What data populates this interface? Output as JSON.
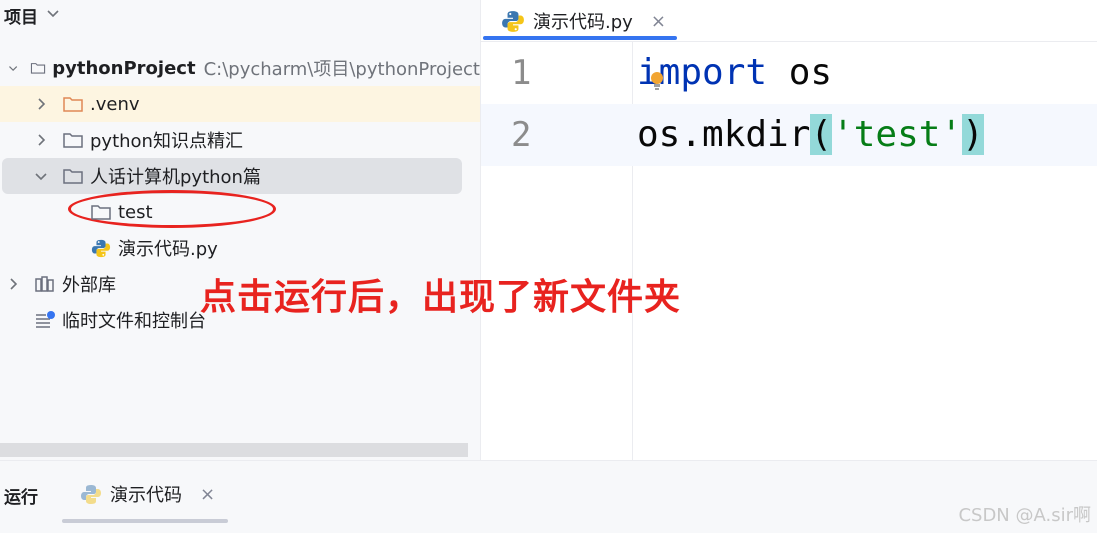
{
  "project_panel": {
    "title": "项目",
    "tree": [
      {
        "label": "pythonProject",
        "hint": "C:\\pycharm\\项目\\pythonProject"
      },
      {
        "label": ".venv"
      },
      {
        "label": "python知识点精汇"
      },
      {
        "label": "人话计算机python篇"
      },
      {
        "label": "test"
      },
      {
        "label": "演示代码.py"
      },
      {
        "label": "外部库"
      },
      {
        "label": "临时文件和控制台"
      }
    ]
  },
  "editor": {
    "tab_label": "演示代码.py",
    "tab_close": "×",
    "lines": [
      {
        "number": "1",
        "keyword": "import",
        "rest": " os"
      },
      {
        "number": "2",
        "prefix": "os.mkdir",
        "open": "(",
        "string": "'test'",
        "close": ")"
      }
    ]
  },
  "bottom_bar": {
    "run_label": "运行",
    "run_tab_label": "演示代码",
    "run_tab_close": "×"
  },
  "annotation": {
    "text": "点击运行后，出现了新文件夹"
  },
  "watermark": "CSDN @A.sir啊",
  "colors": {
    "accent": "#3574f0",
    "annotation_red": "#e8231f",
    "keyword": "#0033b3",
    "string": "#067d17",
    "brace_match": "#93d9d9"
  }
}
